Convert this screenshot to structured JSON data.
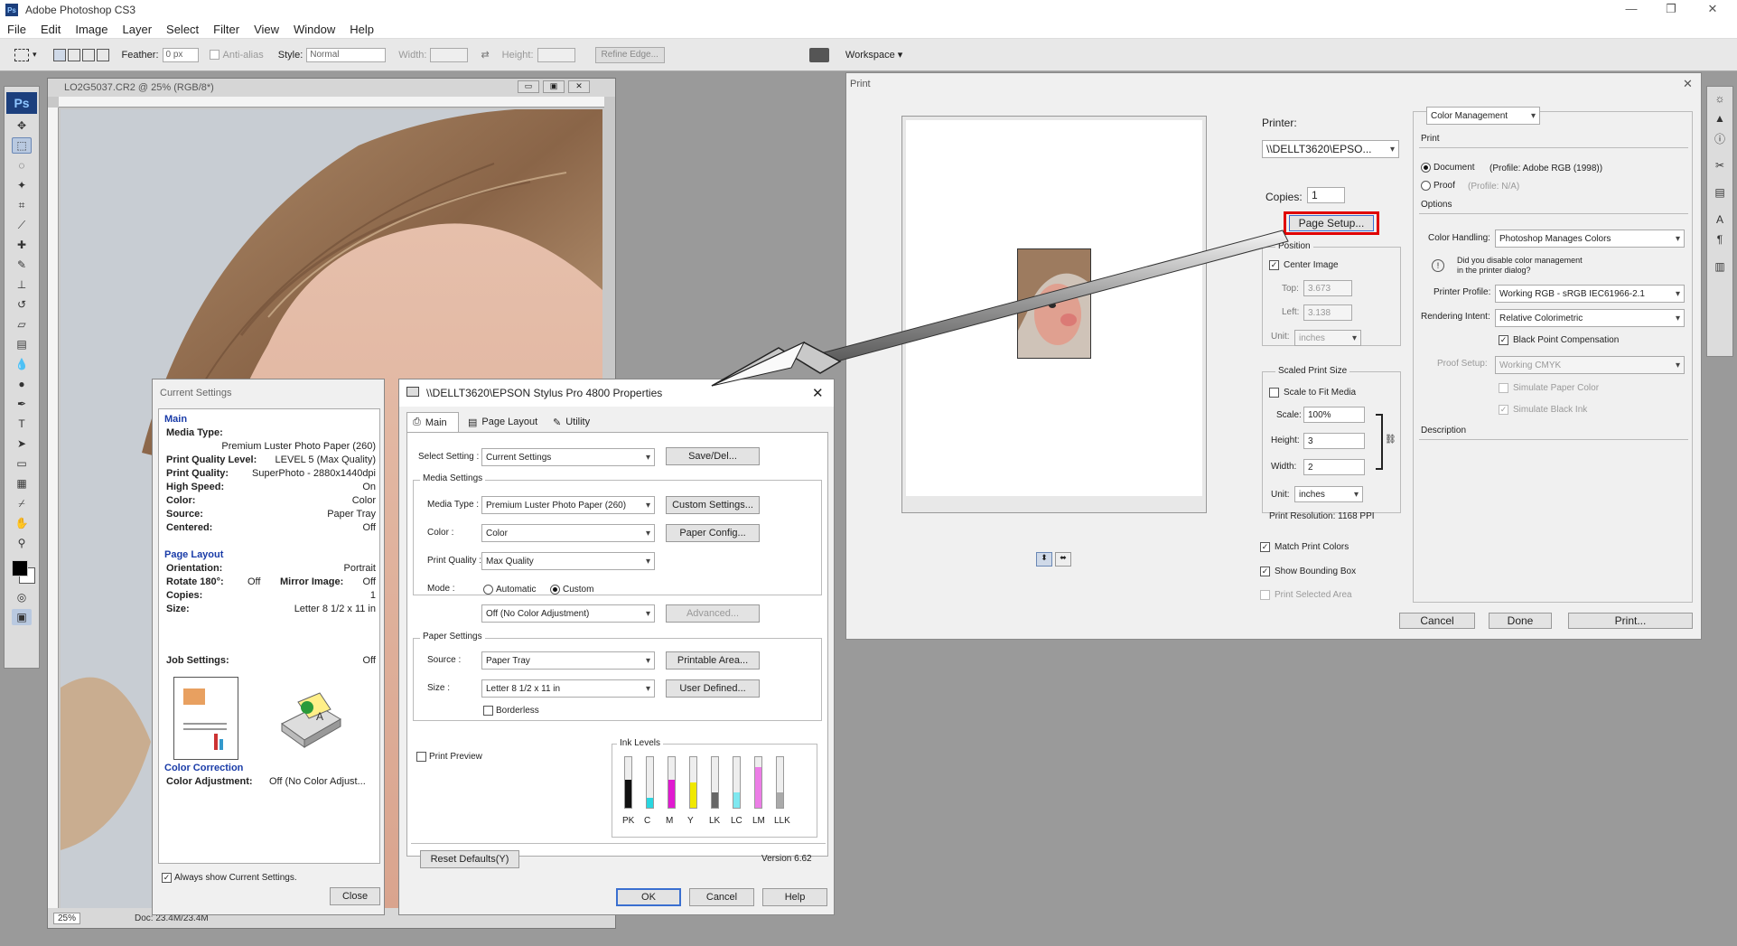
{
  "app": {
    "title": "Adobe Photoshop CS3",
    "icon_text": "Ps"
  },
  "window_controls": {
    "min": "—",
    "restore": "❐",
    "close": "✕"
  },
  "menu": [
    "File",
    "Edit",
    "Image",
    "Layer",
    "Select",
    "Filter",
    "View",
    "Window",
    "Help"
  ],
  "options": {
    "feather_label": "Feather:",
    "feather_value": "0 px",
    "antialias_label": "Anti-alias",
    "style_label": "Style:",
    "style_value": "Normal",
    "width_label": "Width:",
    "height_label": "Height:",
    "refine_edge": "Refine Edge...",
    "workspace": "Workspace ▾"
  },
  "document": {
    "title": "LO2G5037.CR2 @ 25% (RGB/8*)",
    "zoom": "25%",
    "doc_size": "Doc: 23.4M/23.4M"
  },
  "print_dialog": {
    "title": "Print",
    "printer_label": "Printer:",
    "printer_value": "\\\\DELLT3620\\EPSO...",
    "copies_label": "Copies:",
    "copies_value": "1",
    "page_setup": "Page Setup...",
    "position_title": "Position",
    "center_image": "Center Image",
    "top_label": "Top:",
    "top_value": "3.673",
    "left_label": "Left:",
    "left_value": "3.138",
    "unit_label": "Unit:",
    "unit_value": "inches",
    "scaled_title": "Scaled Print Size",
    "scale_to_fit": "Scale to Fit Media",
    "scale_label": "Scale:",
    "scale_value": "100%",
    "height_label": "Height:",
    "height_value": "3",
    "width_label": "Width:",
    "width_value": "2",
    "unit2_label": "Unit:",
    "unit2_value": "inches",
    "print_resolution": "Print Resolution: 1168 PPI",
    "match_print_colors": "Match Print Colors",
    "show_bounding_box": "Show Bounding Box",
    "print_selected_area": "Print Selected Area",
    "cancel": "Cancel",
    "done": "Done",
    "print": "Print...",
    "color_mgmt_select": "Color Management",
    "print_heading": "Print",
    "document_option": "Document",
    "document_profile": "(Profile: Adobe RGB (1998))",
    "proof_option": "Proof",
    "proof_profile": "(Profile: N/A)",
    "options_heading": "Options",
    "color_handling_label": "Color Handling:",
    "color_handling_value": "Photoshop Manages Colors",
    "disable_note_1": "Did you disable color management",
    "disable_note_2": "in the printer dialog?",
    "printer_profile_label": "Printer Profile:",
    "printer_profile_value": "Working RGB - sRGB IEC61966-2.1",
    "rendering_intent_label": "Rendering Intent:",
    "rendering_intent_value": "Relative Colorimetric",
    "black_point": "Black Point Compensation",
    "proof_setup_label": "Proof Setup:",
    "proof_setup_value": "Working CMYK",
    "simulate_paper": "Simulate Paper Color",
    "simulate_black": "Simulate Black Ink",
    "description": "Description"
  },
  "current_settings": {
    "title": "Current Settings",
    "main_heading": "Main",
    "media_type_label": "Media Type:",
    "media_type_value": "Premium Luster Photo Paper (260)",
    "pql_label": "Print Quality Level:",
    "pql_value": "LEVEL 5 (Max Quality)",
    "pq_label": "Print Quality:",
    "pq_value": "SuperPhoto - 2880x1440dpi",
    "hs_label": "High Speed:",
    "hs_value": "On",
    "color_label": "Color:",
    "color_value": "Color",
    "source_label": "Source:",
    "source_value": "Paper Tray",
    "centered_label": "Centered:",
    "centered_value": "Off",
    "page_layout_heading": "Page Layout",
    "orientation_label": "Orientation:",
    "orientation_value": "Portrait",
    "rotate_label": "Rotate 180°:",
    "rotate_value": "Off",
    "mirror_label": "Mirror Image:",
    "mirror_value": "Off",
    "copies_label": "Copies:",
    "copies_value": "1",
    "size_label": "Size:",
    "size_value": "Letter 8 1/2 x 11 in",
    "job_label": "Job Settings:",
    "job_value": "Off",
    "color_correction_heading": "Color Correction",
    "color_adj_label": "Color Adjustment:",
    "color_adj_value": "Off (No Color Adjust...",
    "always_show": "Always show Current Settings.",
    "close": "Close"
  },
  "epson": {
    "title": "\\\\DELLT3620\\EPSON Stylus Pro 4800 Properties",
    "tabs": [
      "Main",
      "Page Layout",
      "Utility"
    ],
    "select_setting_label": "Select Setting :",
    "select_setting_value": "Current Settings",
    "save_del": "Save/Del...",
    "media_settings": "Media Settings",
    "media_type_label": "Media Type :",
    "media_type_value": "Premium Luster Photo Paper (260)",
    "custom_settings": "Custom Settings...",
    "color_label": "Color :",
    "color_value": "Color",
    "paper_config": "Paper Config...",
    "print_quality_label": "Print Quality :",
    "print_quality_value": "Max Quality",
    "mode_label": "Mode :",
    "automatic": "Automatic",
    "custom": "Custom",
    "mode_value": "Off (No Color Adjustment)",
    "advanced": "Advanced...",
    "paper_settings": "Paper Settings",
    "source_label": "Source :",
    "source_value": "Paper Tray",
    "printable_area": "Printable Area...",
    "size_label": "Size :",
    "size_value": "Letter 8 1/2 x 11 in",
    "user_defined": "User Defined...",
    "borderless": "Borderless",
    "print_preview": "Print Preview",
    "ink_levels": "Ink Levels",
    "inks": [
      {
        "name": "PK",
        "color": "#111111",
        "level": 0.55
      },
      {
        "name": "C",
        "color": "#29d6e0",
        "level": 0.2
      },
      {
        "name": "M",
        "color": "#e01ad0",
        "level": 0.55
      },
      {
        "name": "Y",
        "color": "#f0e800",
        "level": 0.5
      },
      {
        "name": "LK",
        "color": "#666666",
        "level": 0.3
      },
      {
        "name": "LC",
        "color": "#7fe8f0",
        "level": 0.3
      },
      {
        "name": "LM",
        "color": "#ec7de6",
        "level": 0.8
      },
      {
        "name": "LLK",
        "color": "#aaaaaa",
        "level": 0.3
      }
    ],
    "reset_defaults": "Reset Defaults(Y)",
    "version": "Version 6.62",
    "ok": "OK",
    "cancel": "Cancel",
    "help": "Help"
  }
}
